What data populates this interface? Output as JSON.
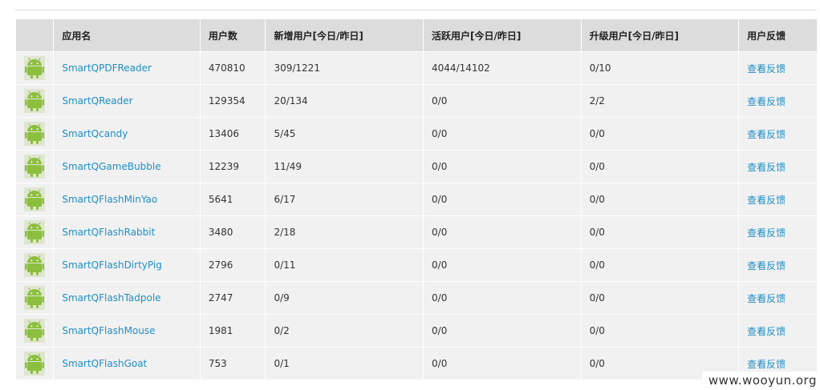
{
  "table": {
    "headers": {
      "icon": "",
      "name": "应用名",
      "users": "用户数",
      "new_users": "新增用户[今日/昨日]",
      "active_users": "活跃用户[今日/昨日]",
      "upgrade_users": "升级用户[今日/昨日]",
      "feedback": "用户反馈"
    },
    "rows": [
      {
        "icon": "android-icon",
        "name": "SmartQPDFReader",
        "users": "470810",
        "new_users": "309/1221",
        "active_users": "4044/14102",
        "upgrade_users": "0/10",
        "feedback": "查看反馈"
      },
      {
        "icon": "android-icon",
        "name": "SmartQReader",
        "users": "129354",
        "new_users": "20/134",
        "active_users": "0/0",
        "upgrade_users": "2/2",
        "feedback": "查看反馈"
      },
      {
        "icon": "android-icon",
        "name": "SmartQcandy",
        "users": "13406",
        "new_users": "5/45",
        "active_users": "0/0",
        "upgrade_users": "0/0",
        "feedback": "查看反馈"
      },
      {
        "icon": "android-icon",
        "name": "SmartQGameBubble",
        "users": "12239",
        "new_users": "11/49",
        "active_users": "0/0",
        "upgrade_users": "0/0",
        "feedback": "查看反馈"
      },
      {
        "icon": "android-icon",
        "name": "SmartQFlashMinYao",
        "users": "5641",
        "new_users": "6/17",
        "active_users": "0/0",
        "upgrade_users": "0/0",
        "feedback": "查看反馈"
      },
      {
        "icon": "android-icon",
        "name": "SmartQFlashRabbit",
        "users": "3480",
        "new_users": "2/18",
        "active_users": "0/0",
        "upgrade_users": "0/0",
        "feedback": "查看反馈"
      },
      {
        "icon": "android-icon",
        "name": "SmartQFlashDirtyPig",
        "users": "2796",
        "new_users": "0/11",
        "active_users": "0/0",
        "upgrade_users": "0/0",
        "feedback": "查看反馈"
      },
      {
        "icon": "android-icon",
        "name": "SmartQFlashTadpole",
        "users": "2747",
        "new_users": "0/9",
        "active_users": "0/0",
        "upgrade_users": "0/0",
        "feedback": "查看反馈"
      },
      {
        "icon": "android-icon",
        "name": "SmartQFlashMouse",
        "users": "1981",
        "new_users": "0/2",
        "active_users": "0/0",
        "upgrade_users": "0/0",
        "feedback": "查看反馈"
      },
      {
        "icon": "android-icon",
        "name": "SmartQFlashGoat",
        "users": "753",
        "new_users": "0/1",
        "active_users": "0/0",
        "upgrade_users": "0/0",
        "feedback": "查看反馈"
      }
    ]
  },
  "watermark": "www.wooyun.org",
  "colors": {
    "header_bg": "#dcdcdc",
    "row_bg": "#f1f1f1",
    "link": "#1f8ec4",
    "android_green": "#8cbf3f"
  }
}
